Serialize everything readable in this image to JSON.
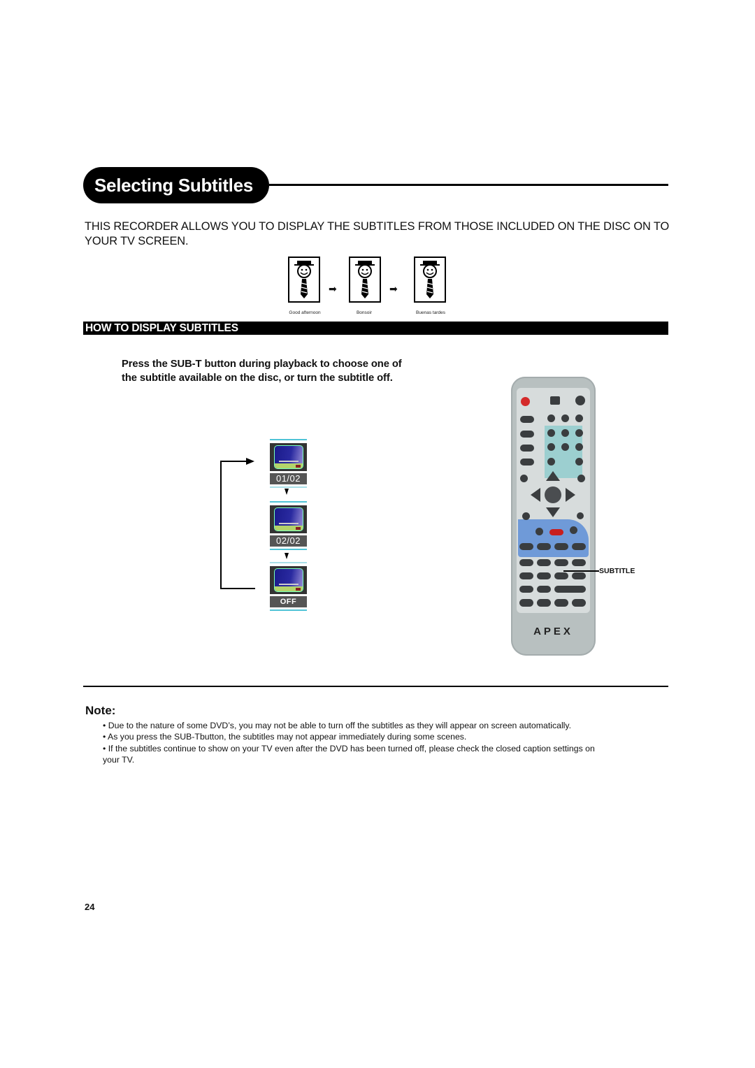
{
  "page": {
    "title": "Selecting Subtitles",
    "intro": "THIS RECORDER ALLOWS YOU TO DISPLAY THE SUBTITLES FROM THOSE INCLUDED ON THE DISC ON TO YOUR TV SCREEN.",
    "page_number": "24"
  },
  "illustration": {
    "icon": "smiley-face-with-hat-and-tie-icon",
    "captions": [
      "Good afternoon",
      "Bonsoir",
      "Buenas tardes"
    ]
  },
  "howto": {
    "heading": "HOW TO DISPLAY SUBTITLES",
    "instruction": "Press the SUB-T button during playback to choose one of the subtitle available on the disc,  or turn the subtitle off."
  },
  "osd_sequence": {
    "icon": "tv-screen-icon",
    "states": [
      "01/02",
      "02/02",
      "OFF"
    ]
  },
  "remote": {
    "brand": "APEX",
    "callout_label": "SUBTITLE",
    "accent_colors": {
      "cyan_zone": "#9ccfd0",
      "blue_zone": "#6f9ad8",
      "standby_button": "#d42a2a",
      "record_button": "#c81e1e"
    }
  },
  "note": {
    "heading": "Note:",
    "items": [
      "• Due to the nature of some DVD’s, you may not be able to turn off the subtitles as they will appear on screen automatically.",
      "• As you press the SUB-Tbutton, the subtitles may not appear immediately during some scenes.",
      "• If the subtitles continue to show on your TV even after the DVD has been turned off, please check the closed caption settings on your TV."
    ]
  }
}
